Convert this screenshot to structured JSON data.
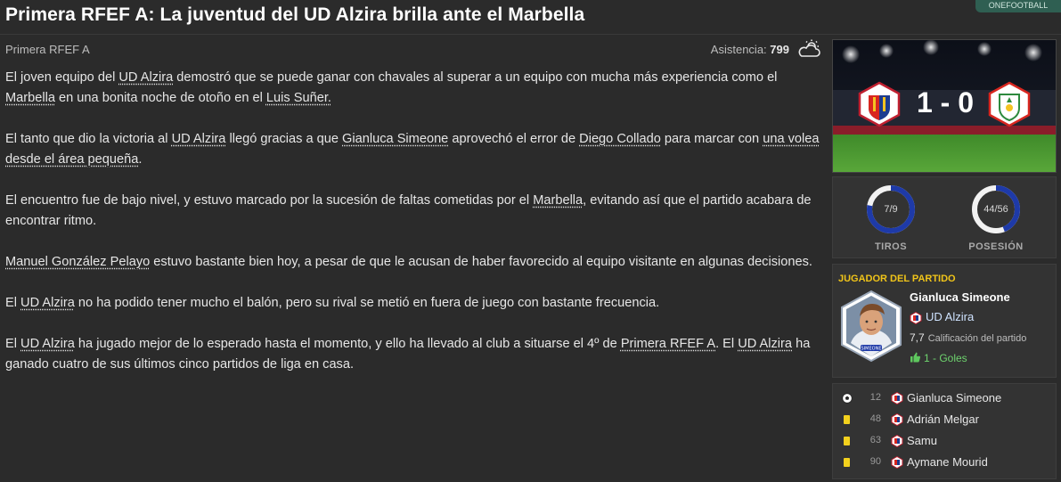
{
  "headline": "Primera RFEF A: La juventud del UD Alzira brilla ante el Marbella",
  "source_tag": "ONEFOOTBALL",
  "meta": {
    "competition": "Primera RFEF A",
    "attendance_label": "Asistencia:",
    "attendance_value": "799",
    "weather_icon": "partly-cloudy-icon"
  },
  "article": {
    "p1": {
      "t1": "El joven equipo del ",
      "l1": "UD Alzira",
      "t2": " demostró que se puede ganar con chavales al superar a un equipo con mucha más experiencia como el ",
      "l2": "Marbella",
      "t3": " en una bonita noche de otoño en el ",
      "l3": "Luis Suñer.",
      "t4": ""
    },
    "p2": {
      "t1": "El tanto que dio la victoria al ",
      "l1": "UD Alzira",
      "t2": " llegó gracias a que ",
      "l2": "Gianluca Simeone",
      "t3": " aprovechó el error de ",
      "l3": "Diego Collado",
      "t4": " para marcar con ",
      "l4": "una volea desde el área pequeña",
      "t5": "."
    },
    "p3": {
      "t1": "El encuentro fue de bajo nivel, y estuvo marcado por la sucesión de faltas cometidas por el ",
      "l1": "Marbella",
      "t2": ", evitando así que el partido acabara de encontrar ritmo."
    },
    "p4": {
      "l1": "Manuel González Pelayo",
      "t1": " estuvo bastante bien hoy, a pesar de que le acusan de haber favorecido al equipo visitante en algunas decisiones."
    },
    "p5": {
      "t1": "El ",
      "l1": "UD Alzira",
      "t2": " no ha podido tener mucho el balón, pero su rival se metió en fuera de juego con bastante frecuencia."
    },
    "p6": {
      "t1": "El ",
      "l1": "UD Alzira",
      "t2": " ha jugado mejor de lo esperado hasta el momento, y ello ha llevado al club a situarse el 4º de ",
      "l2": "Primera RFEF A",
      "t3": ". El ",
      "l3": "UD Alzira",
      "t4": " ha ganado cuatro de sus últimos cinco partidos de liga en casa."
    }
  },
  "score": {
    "text": "1 - 0",
    "home_crest": "ud-alzira-crest-icon",
    "away_crest": "marbella-crest-icon"
  },
  "stats": {
    "shots": {
      "value": "7/9",
      "label": "TIROS",
      "home": 7,
      "total": 9
    },
    "possession": {
      "value": "44/56",
      "label": "POSESIÓN",
      "home": 44,
      "total": 100
    }
  },
  "motm": {
    "title": "JUGADOR DEL PARTIDO",
    "name": "Gianluca Simeone",
    "club": "UD Alzira",
    "rating_value": "7,7",
    "rating_label": "Calificación del partido",
    "goals": "1 - Goles",
    "shirt_label": "SIMEONE"
  },
  "events": [
    {
      "type": "goal",
      "icon": "soccer-ball-icon",
      "minute": "12",
      "player": "Gianluca Simeone"
    },
    {
      "type": "yellow",
      "icon": "yellow-card-icon",
      "minute": "48",
      "player": "Adrián Melgar"
    },
    {
      "type": "yellow",
      "icon": "yellow-card-icon",
      "minute": "63",
      "player": "Samu"
    },
    {
      "type": "yellow",
      "icon": "yellow-card-icon",
      "minute": "90",
      "player": "Aymane Mourid"
    }
  ],
  "colors": {
    "background": "#2b2b2b",
    "accent_yellow": "#f0c419",
    "ring_blue": "#1e3aa8",
    "goal_green": "#6ed36e"
  }
}
